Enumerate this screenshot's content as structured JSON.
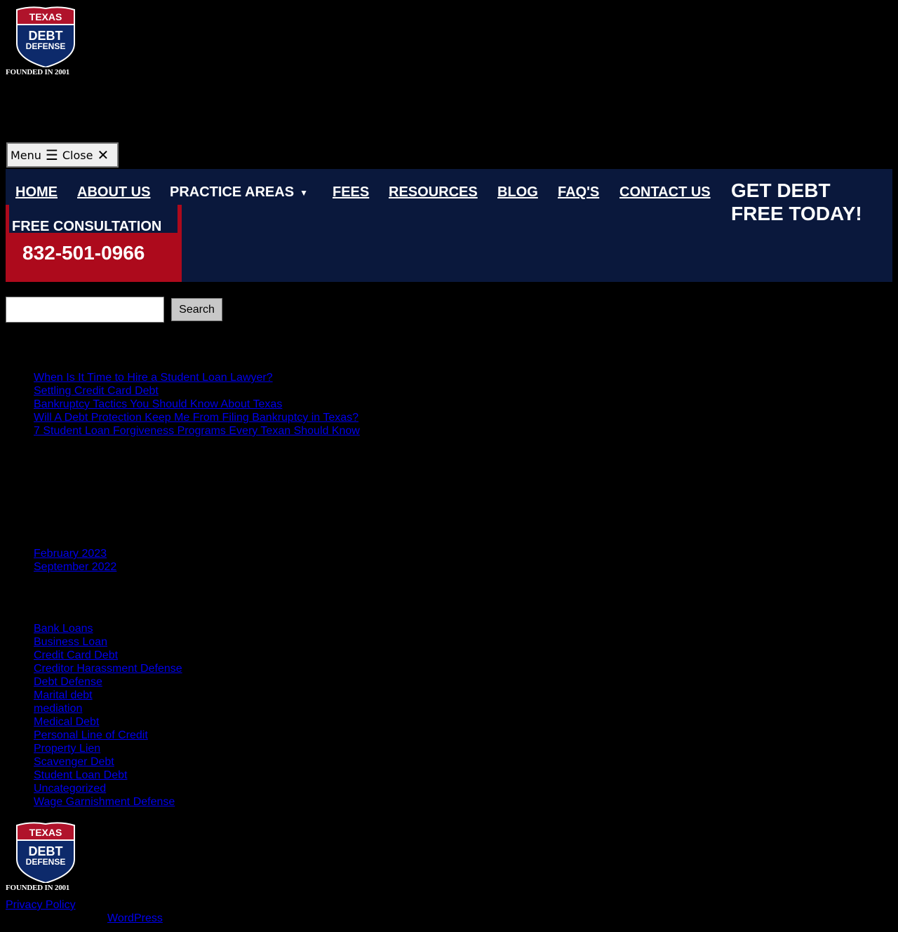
{
  "logo": {
    "line1": "TEXAS",
    "line2": "DEBT",
    "line3": "DEFENSE",
    "founded": "FOUNDED IN 2001"
  },
  "menu_toggle": {
    "menu_label": "Menu",
    "menu_icon": "☰",
    "close_label": "Close",
    "close_icon": "✕"
  },
  "nav": {
    "items": [
      {
        "label": "HOME"
      },
      {
        "label": "ABOUT US"
      },
      {
        "label": "PRACTICE AREAS"
      },
      {
        "label": "FEES"
      },
      {
        "label": "RESOURCES"
      },
      {
        "label": "BLOG"
      },
      {
        "label": "FAQ'S"
      },
      {
        "label": "CONTACT US"
      }
    ],
    "dropdown_icon": "▼",
    "cta_title": "GET DEBT FREE TODAY!",
    "consult_label": "FREE CONSULTATION",
    "phone": "832-501-0966"
  },
  "search": {
    "value": "",
    "button_label": "Search"
  },
  "recent_posts": [
    "When Is It Time to Hire a Student Loan Lawyer?",
    "Settling Credit Card Debt",
    "Bankruptcy Tactics You Should Know About Texas",
    "Will A Debt Protection Keep Me From Filing Bankruptcy in Texas?",
    "7 Student Loan Forgiveness Programs Every Texan Should Know"
  ],
  "archives": [
    "February 2023",
    "September 2022"
  ],
  "categories": [
    "Bank Loans",
    "Business Loan",
    "Credit Card Debt",
    "Creditor Harassment Defense",
    "Debt Defense",
    "Marital debt",
    "mediation",
    "Medical Debt",
    "Personal Line of Credit",
    "Property Lien",
    "Scavenger Debt",
    "Student Loan Debt",
    "Uncategorized",
    "Wage Garnishment Defense"
  ],
  "footer": {
    "privacy_label": "Privacy Policy",
    "wordpress_label": "WordPress"
  },
  "colors": {
    "nav_bg": "#0a183c",
    "accent_red": "#ad0a1c",
    "link": "#0000ee"
  }
}
